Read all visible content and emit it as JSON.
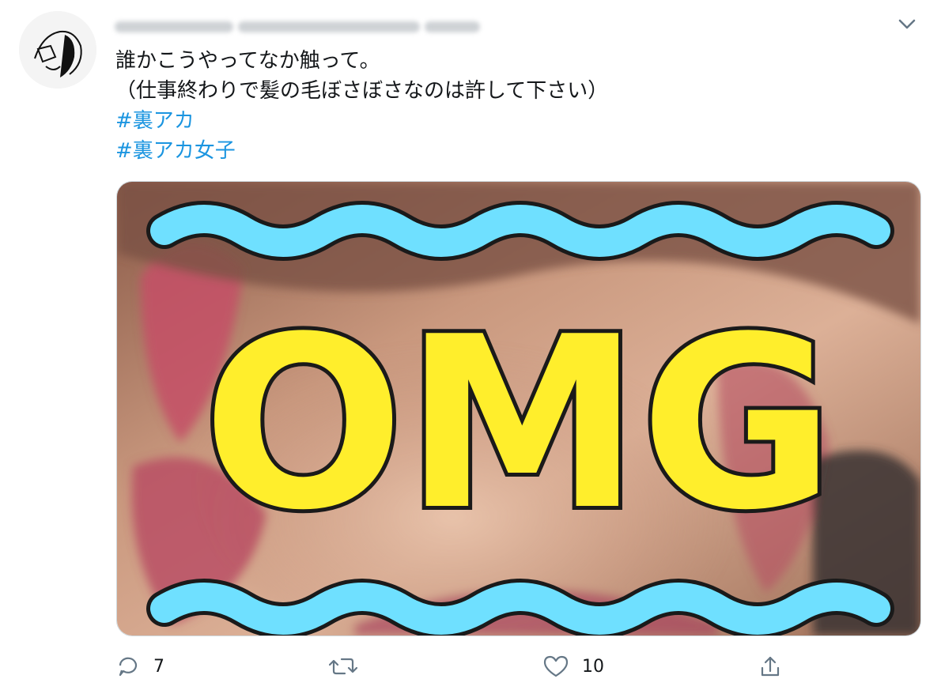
{
  "tweet": {
    "lines": [
      "誰かこうやってなか触って。",
      "（仕事終わりで髪の毛ぼさぼさなのは許して下さい）"
    ],
    "hashtags": [
      "#裏アカ",
      "#裏アカ女子"
    ]
  },
  "media": {
    "overlay_text": "OMG",
    "colors": {
      "wave": "#6fe0ff",
      "text_fill": "#ffee2c",
      "outline": "#1a1a1a"
    }
  },
  "actions": {
    "reply_count": "7",
    "retweet_count": "",
    "like_count": "10"
  },
  "icons": [
    "avatar-icon",
    "chevron-down-icon",
    "reply-icon",
    "retweet-icon",
    "like-icon",
    "share-icon"
  ]
}
